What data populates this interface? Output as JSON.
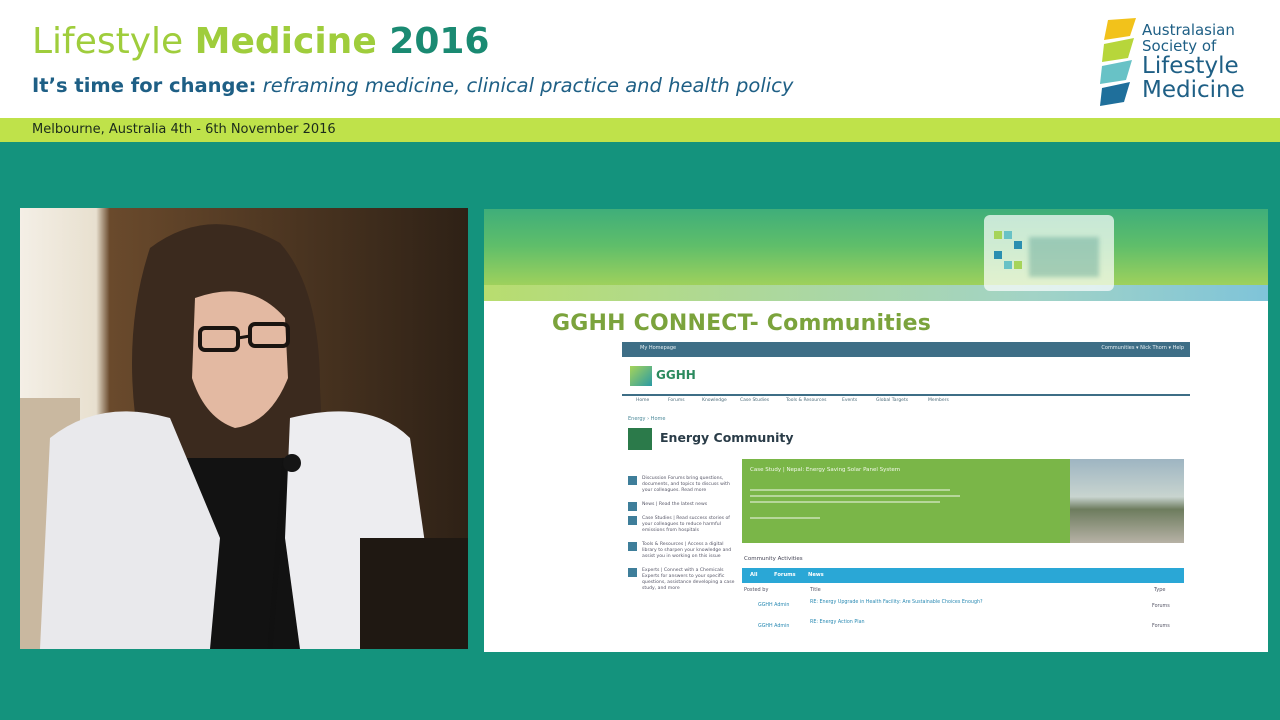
{
  "header": {
    "title_part1": "Lifestyle ",
    "title_part2": "Medicine ",
    "title_part3": "2016",
    "subtitle_bold": "It’s time for change:",
    "subtitle_italic": "reframing medicine, clinical practice and health policy",
    "location_date": "Melbourne, Australia 4th - 6th November 2016"
  },
  "logo": {
    "line1": "Australasian",
    "line2": "Society of",
    "line3": "Lifestyle",
    "line4": "Medicine"
  },
  "slide": {
    "title": "GGHH CONNECT- Communities",
    "site": {
      "nav_left": "My Homepage",
      "nav_right": "Communities ▾     Nick Thorn ▾     Help",
      "logo_text": "GGHH",
      "menu": [
        "Home",
        "Forums",
        "Knowledge",
        "Case Studies",
        "Tools & Resources",
        "Events",
        "Global Targets",
        "Members"
      ],
      "breadcrumb": "Energy › Home",
      "page_title": "Energy Community",
      "sidebar": [
        "Discussion Forums bring questions, documents, and topics to discuss with your colleagues. Read more",
        "News | Read the latest news",
        "Case Studies | Read success stories of your colleagues to reduce harmful emissions from hospitals",
        "Tools & Resources | Access a digital library to sharpen your knowledge and assist you in working on this issue",
        "Experts | Connect with a Chemicals Experts for answers to your specific questions, assistance developing a case study, and more"
      ],
      "banner_text": "Case Study | Nepal: Energy Saving Solar Panel System",
      "activities_label": "Community Activities",
      "activity_tabs": [
        "All",
        "Forums",
        "News"
      ],
      "columns": [
        "Posted by",
        "Title",
        "Type"
      ],
      "rows": [
        {
          "by": "GGHH Admin",
          "title": "RE: Energy Upgrade in Health Facility: Are Sustainable Choices Enough?",
          "type": "Forums"
        },
        {
          "by": "GGHH Admin",
          "title": "RE: Energy Action Plan",
          "type": "Forums"
        }
      ]
    }
  },
  "colors": {
    "background": "#14937d",
    "accent_green": "#9fcd3c",
    "accent_dark": "#1a8a72",
    "subtitle_blue": "#1e5f85",
    "band": "#bfe24a"
  }
}
